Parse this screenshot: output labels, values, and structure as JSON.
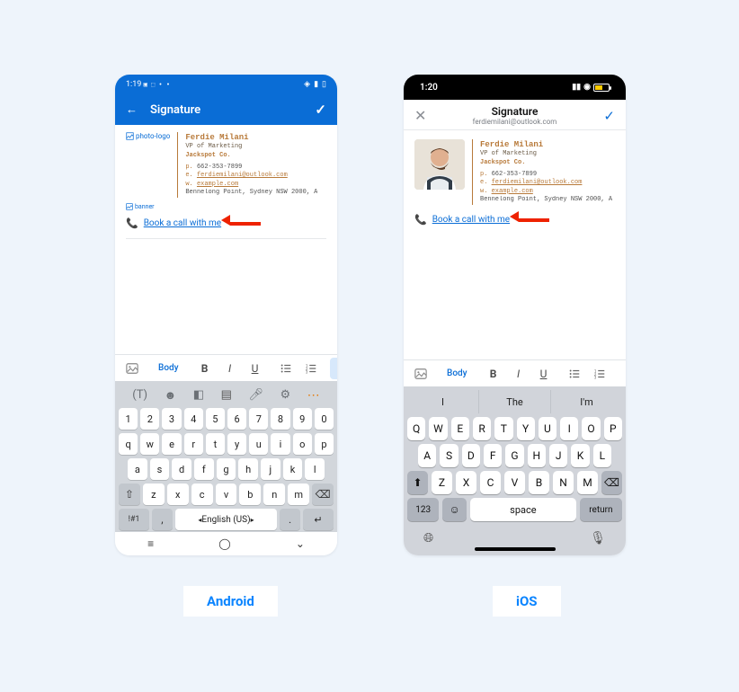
{
  "labels": {
    "android": "Android",
    "ios": "iOS"
  },
  "android": {
    "status_time": "1:19",
    "status_icons_left": "▣ ⬚ ▫ ▫",
    "header_title": "Signature",
    "photo_alt": "photo-logo",
    "banner_alt": "banner",
    "book_link": "Book a call with me",
    "toolbar_body": "Body",
    "keyboard": {
      "lang": "English (US)",
      "numrow": [
        "1",
        "2",
        "3",
        "4",
        "5",
        "6",
        "7",
        "8",
        "9",
        "0"
      ],
      "row1": [
        "q",
        "w",
        "e",
        "r",
        "t",
        "y",
        "u",
        "i",
        "o",
        "p"
      ],
      "row2": [
        "a",
        "s",
        "d",
        "f",
        "g",
        "h",
        "j",
        "k",
        "l"
      ],
      "row3": [
        "z",
        "x",
        "c",
        "v",
        "b",
        "n",
        "m"
      ],
      "sym": "!#1",
      "comma": ",",
      "dot": "."
    }
  },
  "ios": {
    "status_time": "1:20",
    "header_title": "Signature",
    "header_email": "ferdiemilani@outlook.com",
    "book_link": "Book a call with me",
    "toolbar_body": "Body",
    "suggestions": [
      "I",
      "The",
      "I'm"
    ],
    "keyboard": {
      "row1": [
        "Q",
        "W",
        "E",
        "R",
        "T",
        "Y",
        "U",
        "I",
        "O",
        "P"
      ],
      "row2": [
        "A",
        "S",
        "D",
        "F",
        "G",
        "H",
        "J",
        "K",
        "L"
      ],
      "row3": [
        "Z",
        "X",
        "C",
        "V",
        "B",
        "N",
        "M"
      ],
      "k123": "123",
      "space": "space",
      "return": "return"
    }
  },
  "signature": {
    "name": "Ferdie Milani",
    "role": "VP of Marketing",
    "company": "Jackspot Co.",
    "phone_lbl": "p.",
    "phone": "662-353-7899",
    "email_lbl": "e.",
    "email": "ferdiemilani@outlook.com",
    "web_lbl": "w.",
    "web": "example.com",
    "address": "Bennelong Point, Sydney NSW 2000, A"
  }
}
